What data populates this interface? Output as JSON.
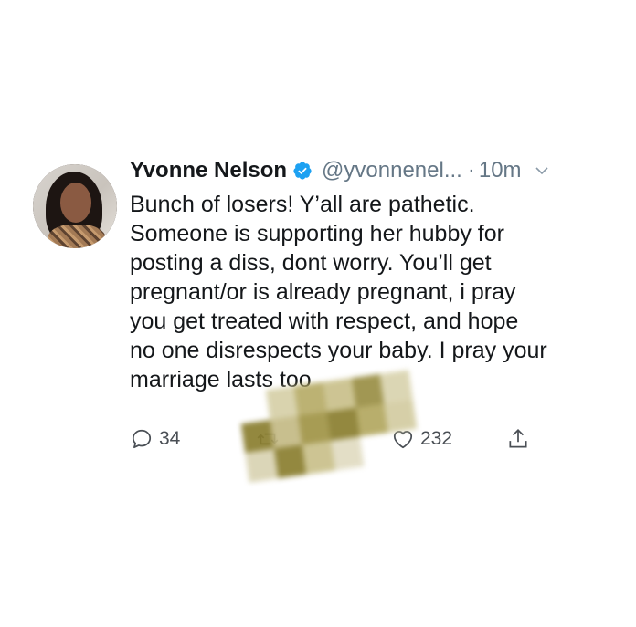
{
  "tweet": {
    "display_name": "Yvonne Nelson",
    "handle": "@yvonnenel...",
    "separator": "·",
    "time": "10m",
    "lines": [
      "Bunch of losers! Y’all are pathetic.",
      "Someone is supporting her hubby for",
      "posting a diss, dont worry. You’ll get",
      "pregnant/or is already pregnant, i pray",
      "you get treated with respect, and hope",
      "no one disrespects your baby. I pray your",
      "marriage lasts too"
    ],
    "reply_count": "34",
    "like_count": "232"
  },
  "icons": {
    "verified": "verified-badge-icon",
    "menu": "chevron-down-icon",
    "reply": "reply-icon",
    "retweet": "retweet-icon",
    "like": "heart-icon",
    "share": "share-icon"
  },
  "colors": {
    "text": "#14171a",
    "muted": "#657786",
    "verified": "#1da1f2",
    "censor_dark": "#8a7e2f",
    "censor_light": "#c9c08a"
  }
}
